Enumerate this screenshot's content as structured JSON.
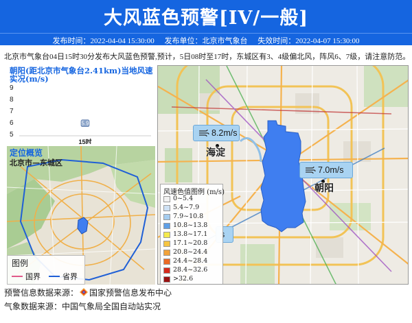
{
  "header": {
    "title": "大风蓝色预警[IV/一般]",
    "issue_time": "发布时间：2022-04-04 15:30:00",
    "issuer": "发布单位：北京市气象台",
    "expire_time": "失效时间：2022-04-07 15:30:00",
    "color": "#1565e0"
  },
  "warning_text": "北京市气象台04日15时30分发布大风蓝色预警,预计，5日08时至17时，东城区有3、4级偏北风，阵风6、7级，请注意防范。",
  "wind_chart": {
    "title": "朝阳(距北京市气象台2.41km)当地风速实况(m/s)",
    "chart_data": {
      "type": "scatter",
      "categories": [
        "15时"
      ],
      "values": [
        5.9
      ],
      "value_labels": [
        "5.9"
      ],
      "ylim": [
        5,
        9
      ],
      "yticks": [
        "9",
        "8",
        "7",
        "6",
        "5"
      ],
      "grid": false
    }
  },
  "location": {
    "title": "定位概览",
    "region": "北京市—东城区",
    "legend_title": "图例",
    "legend_items": [
      {
        "label": "国界",
        "color": "#e05a8a"
      },
      {
        "label": "省界",
        "color": "#1f5fd6"
      }
    ]
  },
  "main_map": {
    "callouts": [
      {
        "text": "8.2m/s"
      },
      {
        "text": "7.0m/s"
      }
    ],
    "districts": [
      {
        "name": "海淀"
      },
      {
        "name": "朝阳"
      }
    ],
    "partial_label": "s",
    "scale_legend": {
      "title": "风速色值图例 (m/s)",
      "items": [
        {
          "label": "0~5.4",
          "color": "#f2f2f2"
        },
        {
          "label": "5.4~7.9",
          "color": "#cfe2f5"
        },
        {
          "label": "7.9~10.8",
          "color": "#a5cdf0"
        },
        {
          "label": "10.8~13.8",
          "color": "#5f9fe6"
        },
        {
          "label": "13.8~17.1",
          "color": "#f4ea4c"
        },
        {
          "label": "17.1~20.8",
          "color": "#f6c542"
        },
        {
          "label": "20.8~24.4",
          "color": "#f2a33a"
        },
        {
          "label": "24.4~28.4",
          "color": "#ec6a25"
        },
        {
          "label": "28.4~32.6",
          "color": "#d62a1c"
        },
        {
          "label": ">32.6",
          "color": "#9a1212"
        }
      ]
    },
    "district_fill": "#3f7ef0"
  },
  "footer": {
    "warning_source": "预警信息数据来源：",
    "warning_source_org": "国家预警信息发布中心",
    "weather_source": "气象数据来源：中国气象局全国自动站实况"
  }
}
